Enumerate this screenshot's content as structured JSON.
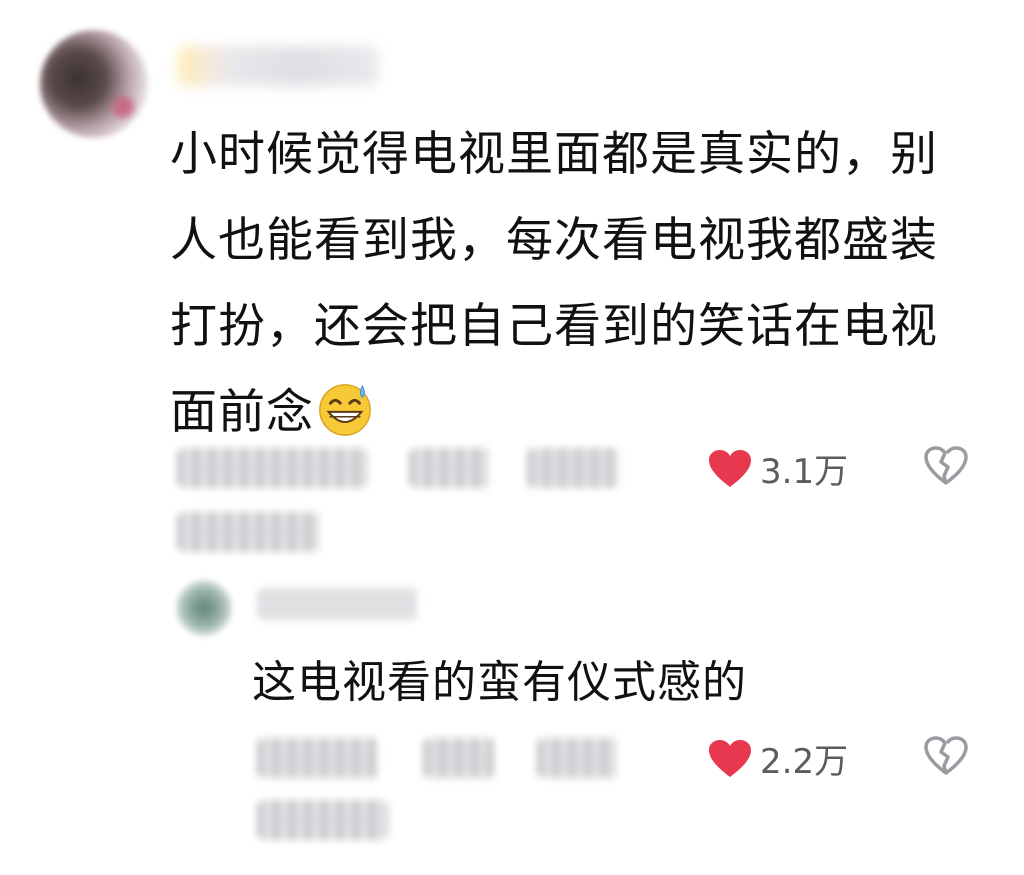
{
  "comment": {
    "text": "小时候觉得电视里面都是真实的，别人也能看到我，每次看电视我都盛装打扮，还会把自己看到的笑话在电视面前念",
    "lines": [
      "小时候觉得电视里面都是真实的，别",
      "人也能看到我，每次看电视我都盛装",
      "打扮，还会把自己看到的笑话在电视",
      "面前念"
    ],
    "emoji": "grinning-sweat-emoji",
    "likes": "3.1万"
  },
  "reply": {
    "text": "这电视看的蛮有仪式感的",
    "likes": "2.2万"
  },
  "colors": {
    "heart": "#e8384f",
    "text": "#111111",
    "count": "#5b5b62",
    "dislike": "#9a9aa0"
  }
}
